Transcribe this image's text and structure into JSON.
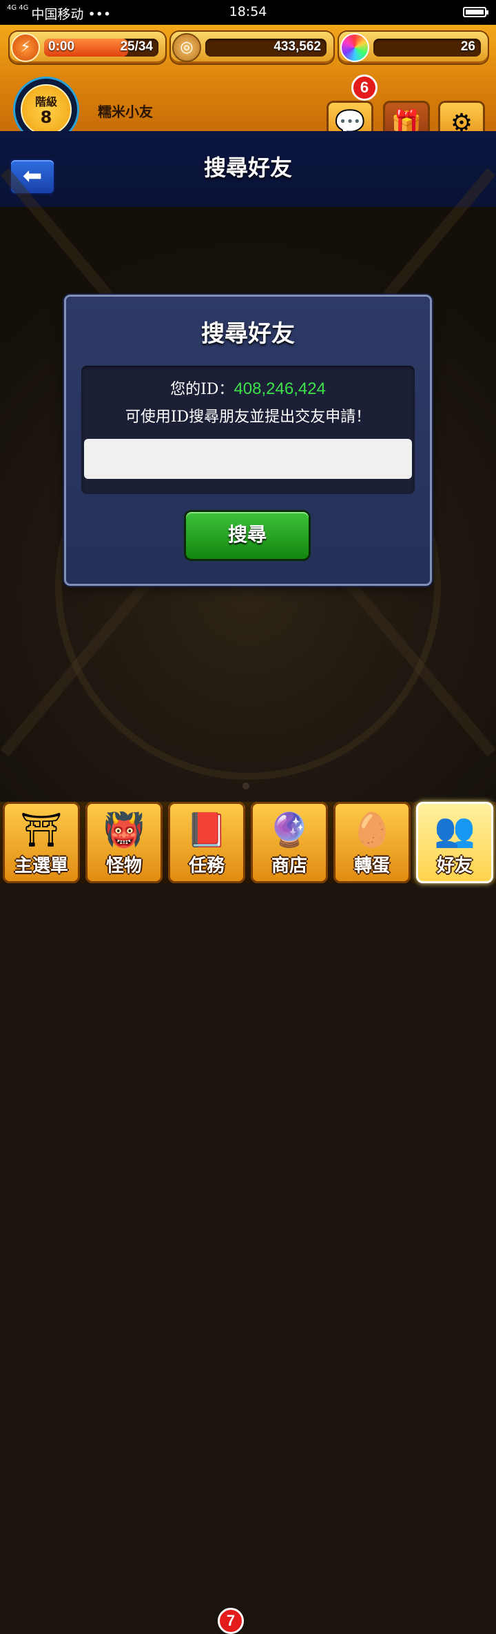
{
  "status_bar": {
    "network": "4G 4G",
    "carrier": "中国移动 •••",
    "time": "18:54"
  },
  "header": {
    "stamina": {
      "text": "0:00",
      "count": "25/34",
      "fill": 0.735
    },
    "coins": {
      "value": "433,562"
    },
    "orbs": {
      "value": "26"
    },
    "rank": {
      "label": "階級",
      "value": "8"
    },
    "player_name": "糯米小友",
    "chat_badge": "6"
  },
  "title_bar": {
    "title": "搜尋好友"
  },
  "dialog": {
    "title": "搜尋好友",
    "id_label": "您的ID：",
    "id_value": "408,246,424",
    "hint": "可使用ID搜尋朋友並提出交友申請！",
    "input_value": "",
    "input_placeholder": "",
    "search_button": "搜尋"
  },
  "bottom_nav": {
    "items": [
      {
        "label": "主選單",
        "icon": "gate-icon"
      },
      {
        "label": "怪物",
        "icon": "monster-icon"
      },
      {
        "label": "任務",
        "icon": "book-icon",
        "badge": "7"
      },
      {
        "label": "商店",
        "icon": "orb-icon"
      },
      {
        "label": "轉蛋",
        "icon": "egg-icon"
      },
      {
        "label": "好友",
        "icon": "friends-icon",
        "active": true
      }
    ]
  },
  "colors": {
    "header_gold": "#f3a81a",
    "id_green": "#3ee04a",
    "dialog_bg": "#2d3a66",
    "search_green": "#12860f",
    "badge_red": "#e31b1b"
  }
}
